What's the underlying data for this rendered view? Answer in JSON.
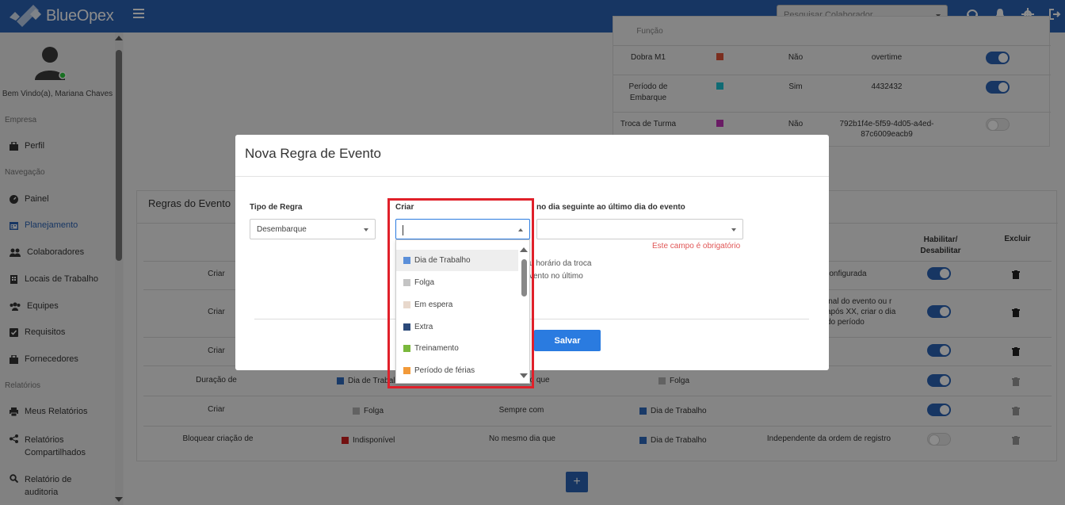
{
  "header": {
    "brand": "BlueOpex",
    "search_placeholder": "Pesquisar Colaborador"
  },
  "sidebar": {
    "welcome": "Bem Vindo(a), Mariana Chaves",
    "sections": {
      "empresa": "Empresa",
      "navegacao": "Navegação",
      "relatorios": "Relatórios"
    },
    "items": [
      {
        "label": "Perfil",
        "icon": "briefcase-icon"
      },
      {
        "label": "Painel",
        "icon": "dashboard-icon"
      },
      {
        "label": "Planejamento",
        "icon": "calendar-icon"
      },
      {
        "label": "Colaboradores",
        "icon": "users-icon"
      },
      {
        "label": "Locais de Trabalho",
        "icon": "building-icon"
      },
      {
        "label": "Equipes",
        "icon": "team-icon"
      },
      {
        "label": "Requisitos",
        "icon": "checkbox-icon"
      },
      {
        "label": "Fornecedores",
        "icon": "briefcase-icon"
      },
      {
        "label": "Meus Relatórios",
        "icon": "print-icon"
      },
      {
        "label": "Relatórios Compartilhados",
        "icon": "share-icon"
      },
      {
        "label": "Relatório de auditoria",
        "icon": "search-doc-icon"
      }
    ]
  },
  "event_types_table": {
    "rows": [
      {
        "name": "Dobra M1",
        "color": "#e0553a",
        "flag": "Não",
        "code": "overtime",
        "enabled": true
      },
      {
        "name": "Período de Embarque",
        "color": "#1ec3d3",
        "flag": "Sim",
        "code": "4432432",
        "enabled": true
      },
      {
        "name": "Troca de Turma",
        "color": "#c233b8",
        "flag": "Não",
        "code": "792b1f4e-5f59-4d05-a4ed-87c6009eacb9",
        "enabled": false
      }
    ],
    "partial_top": "Função"
  },
  "rules_card": {
    "title": "Regras do Evento",
    "col_enable": "Habilitar/ Desabilitar",
    "col_delete": "Excluir",
    "rows": [
      {
        "action": "Criar",
        "tail": "a configurada",
        "enabled": true
      },
      {
        "action": "Criar",
        "tail": "inal do evento ou r após XX, criar o dia do período",
        "enabled": true
      },
      {
        "action": "Criar",
        "tail": "",
        "enabled": true
      },
      {
        "action": "Duração de",
        "event": "Dia de Trabal",
        "cond": "ão que",
        "target": "Folga",
        "target_color": "#b3b3b3",
        "enabled": true
      },
      {
        "action": "Criar",
        "event": "Folga",
        "event_color": "#b3b3b3",
        "cond": "Sempre com",
        "target": "Dia de Trabalho",
        "target_color": "#2e6bbd",
        "enabled": true
      },
      {
        "action": "Bloquear criação de",
        "event": "Indisponível",
        "event_color": "#d11f1f",
        "cond": "No mesmo dia que",
        "target": "Dia de Trabalho",
        "target_color": "#2e6bbd",
        "extra": "Independente da ordem de registro",
        "enabled": false
      }
    ]
  },
  "modal": {
    "title": "Nova Regra de Evento",
    "tipo_label": "Tipo de Regra",
    "tipo_value": "Desembarque",
    "criar_label": "Criar",
    "criar_value": "",
    "third_label": "no dia seguinte ao último dia do evento",
    "third_value": "",
    "error": "Este campo é obrigatório",
    "hint1": "u horário da troca",
    "hint2": "vento no último",
    "save": "Salvar"
  },
  "dropdown": {
    "options": [
      {
        "label": "Dia de Trabalho",
        "color": "#5b8fd9",
        "highlighted": true
      },
      {
        "label": "Folga",
        "color": "#c4c4c4"
      },
      {
        "label": "Em espera",
        "color": "#e8d8cc"
      },
      {
        "label": "Extra",
        "color": "#2c4a7a"
      },
      {
        "label": "Treinamento",
        "color": "#7ab83c"
      },
      {
        "label": "Período de férias",
        "color": "#f29a3a"
      }
    ]
  },
  "add_button": "+"
}
